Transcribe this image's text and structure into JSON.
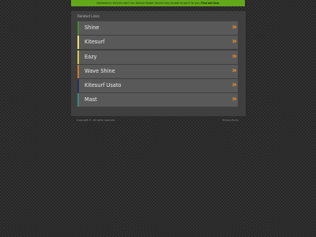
{
  "banner": {
    "text_lead": "Interested in verychk.com? Our Domain Broker Service may be able to get it for you. ",
    "text_cta": "Find out how.",
    "color": "#63a81b"
  },
  "related": {
    "title": "Related Links",
    "chevron": "»",
    "accent": "#e6902a",
    "items": [
      {
        "label": "Shine",
        "color": "#4a8a2c"
      },
      {
        "label": "Kitesurf",
        "color": "#e8e66a"
      },
      {
        "label": "Eazy",
        "color": "#d8c94a"
      },
      {
        "label": "Wave Shine",
        "color": "#d0762a"
      },
      {
        "label": "Kitesurf Usato",
        "color": "#2a2f5a"
      },
      {
        "label": "Mast",
        "color": "#3a8a7a"
      }
    ]
  },
  "footer": {
    "copyright": "Copyright ©. All rights reserved.",
    "privacy": "Privacy Policy"
  }
}
